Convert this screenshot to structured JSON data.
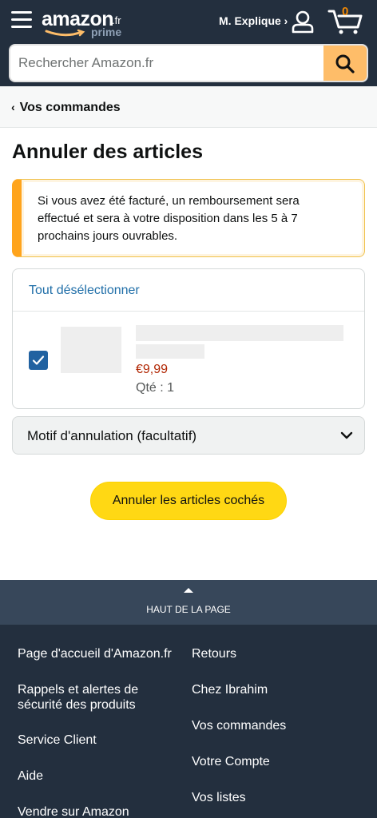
{
  "header": {
    "logo_main": "amazon",
    "logo_tld": ".fr",
    "logo_prime": "prime",
    "account_label": "M. Explique ›",
    "cart_count": "0",
    "brand_color": "#232f3e",
    "accent_color": "#febd69"
  },
  "search": {
    "placeholder": "Rechercher Amazon.fr"
  },
  "breadcrumb": {
    "label": "Vos commandes"
  },
  "page": {
    "title": "Annuler des articles",
    "alert_text": "Si vous avez été facturé, un remboursement sera effectué et sera à votre disposition dans les 5 à 7 prochains jours ouvrables."
  },
  "items": {
    "deselect_all": "Tout désélectionner",
    "list": [
      {
        "price": "€9,99",
        "quantity": "Qté : 1",
        "checked": true
      }
    ]
  },
  "reason": {
    "label": "Motif d'annulation (facultatif)"
  },
  "actions": {
    "cancel_label": "Annuler les articles cochés"
  },
  "footer": {
    "back_to_top": "HAUT DE LA PAGE",
    "left_links": [
      "Page d'accueil d'Amazon.fr",
      "Rappels et alertes de sécurité des produits",
      "Service Client",
      "Aide",
      "Vendre sur Amazon"
    ],
    "right_links": [
      "Retours",
      "Chez Ibrahim",
      "Vos commandes",
      "Votre Compte",
      "Vos listes"
    ]
  },
  "icons": {
    "menu": "hamburger-icon",
    "user": "user-icon",
    "cart": "cart-icon",
    "search": "search-icon",
    "back": "chevron-left-icon",
    "expand": "chevron-down-icon",
    "check": "checkmark-icon"
  }
}
